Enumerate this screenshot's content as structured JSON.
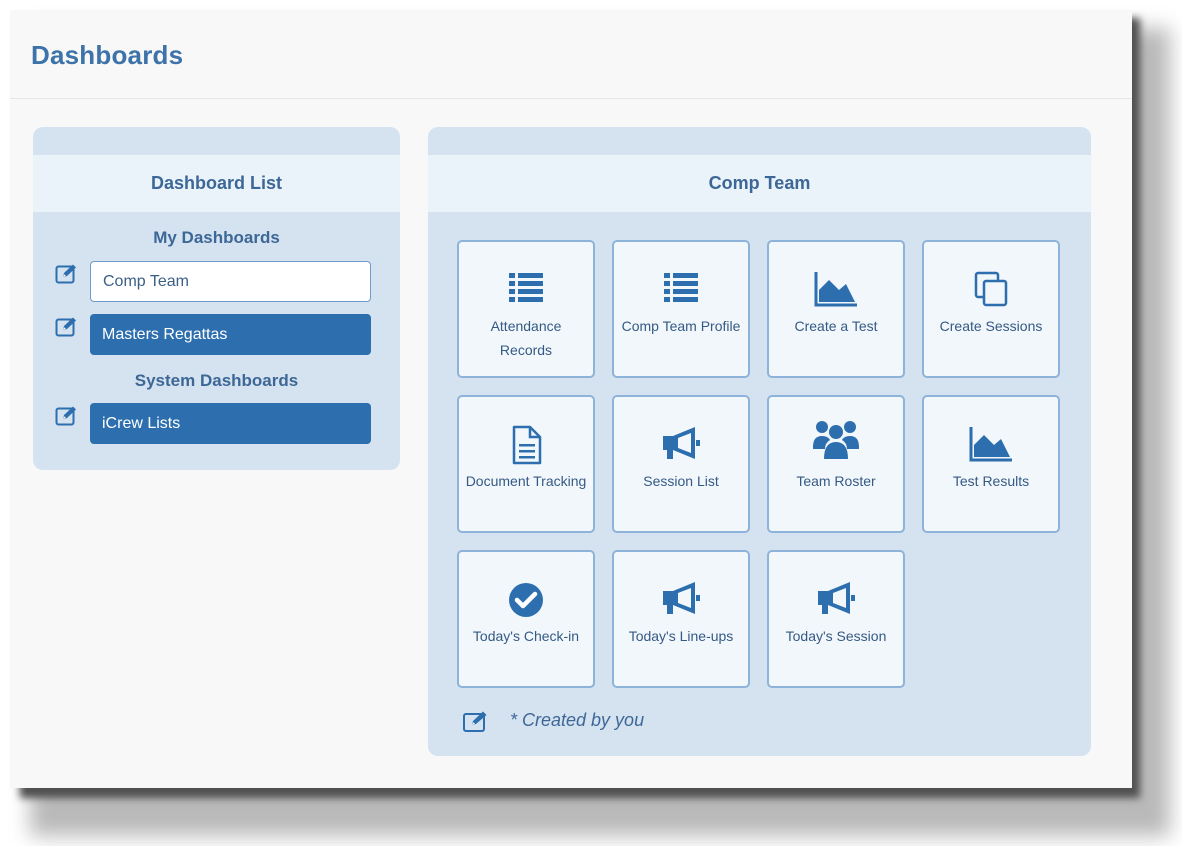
{
  "page": {
    "title": "Dashboards"
  },
  "dashboard_list": {
    "title": "Dashboard List",
    "my_dashboards_label": "My Dashboards",
    "my_dashboards": [
      {
        "label": "Comp Team",
        "selected": true
      },
      {
        "label": "Masters Regattas",
        "selected": false
      }
    ],
    "system_dashboards_label": "System Dashboards",
    "system_dashboards": [
      {
        "label": "iCrew Lists",
        "selected": false
      }
    ]
  },
  "current_dashboard": {
    "title": "Comp Team",
    "tiles": [
      {
        "label": "Attendance Records",
        "icon": "list-icon"
      },
      {
        "label": "Comp Team Profile",
        "icon": "list-icon"
      },
      {
        "label": "Create a Test",
        "icon": "area-chart-icon"
      },
      {
        "label": "Create Sessions",
        "icon": "copy-icon"
      },
      {
        "label": "Document Tracking",
        "icon": "document-icon"
      },
      {
        "label": "Session List",
        "icon": "megaphone-icon"
      },
      {
        "label": "Team Roster",
        "icon": "users-icon"
      },
      {
        "label": "Test Results",
        "icon": "area-chart-icon"
      },
      {
        "label": "Today's Check-in",
        "icon": "check-circle-icon"
      },
      {
        "label": "Today's Line-ups",
        "icon": "megaphone-icon"
      },
      {
        "label": "Today's Session",
        "icon": "megaphone-icon"
      }
    ],
    "footnote": "* Created by you"
  },
  "colors": {
    "brand_blue": "#2d6fae",
    "title_blue": "#3d73a9",
    "panel_bg": "#d5e3f1",
    "panel_head_bg": "#eaf2fa",
    "tile_border": "#8db3da"
  }
}
